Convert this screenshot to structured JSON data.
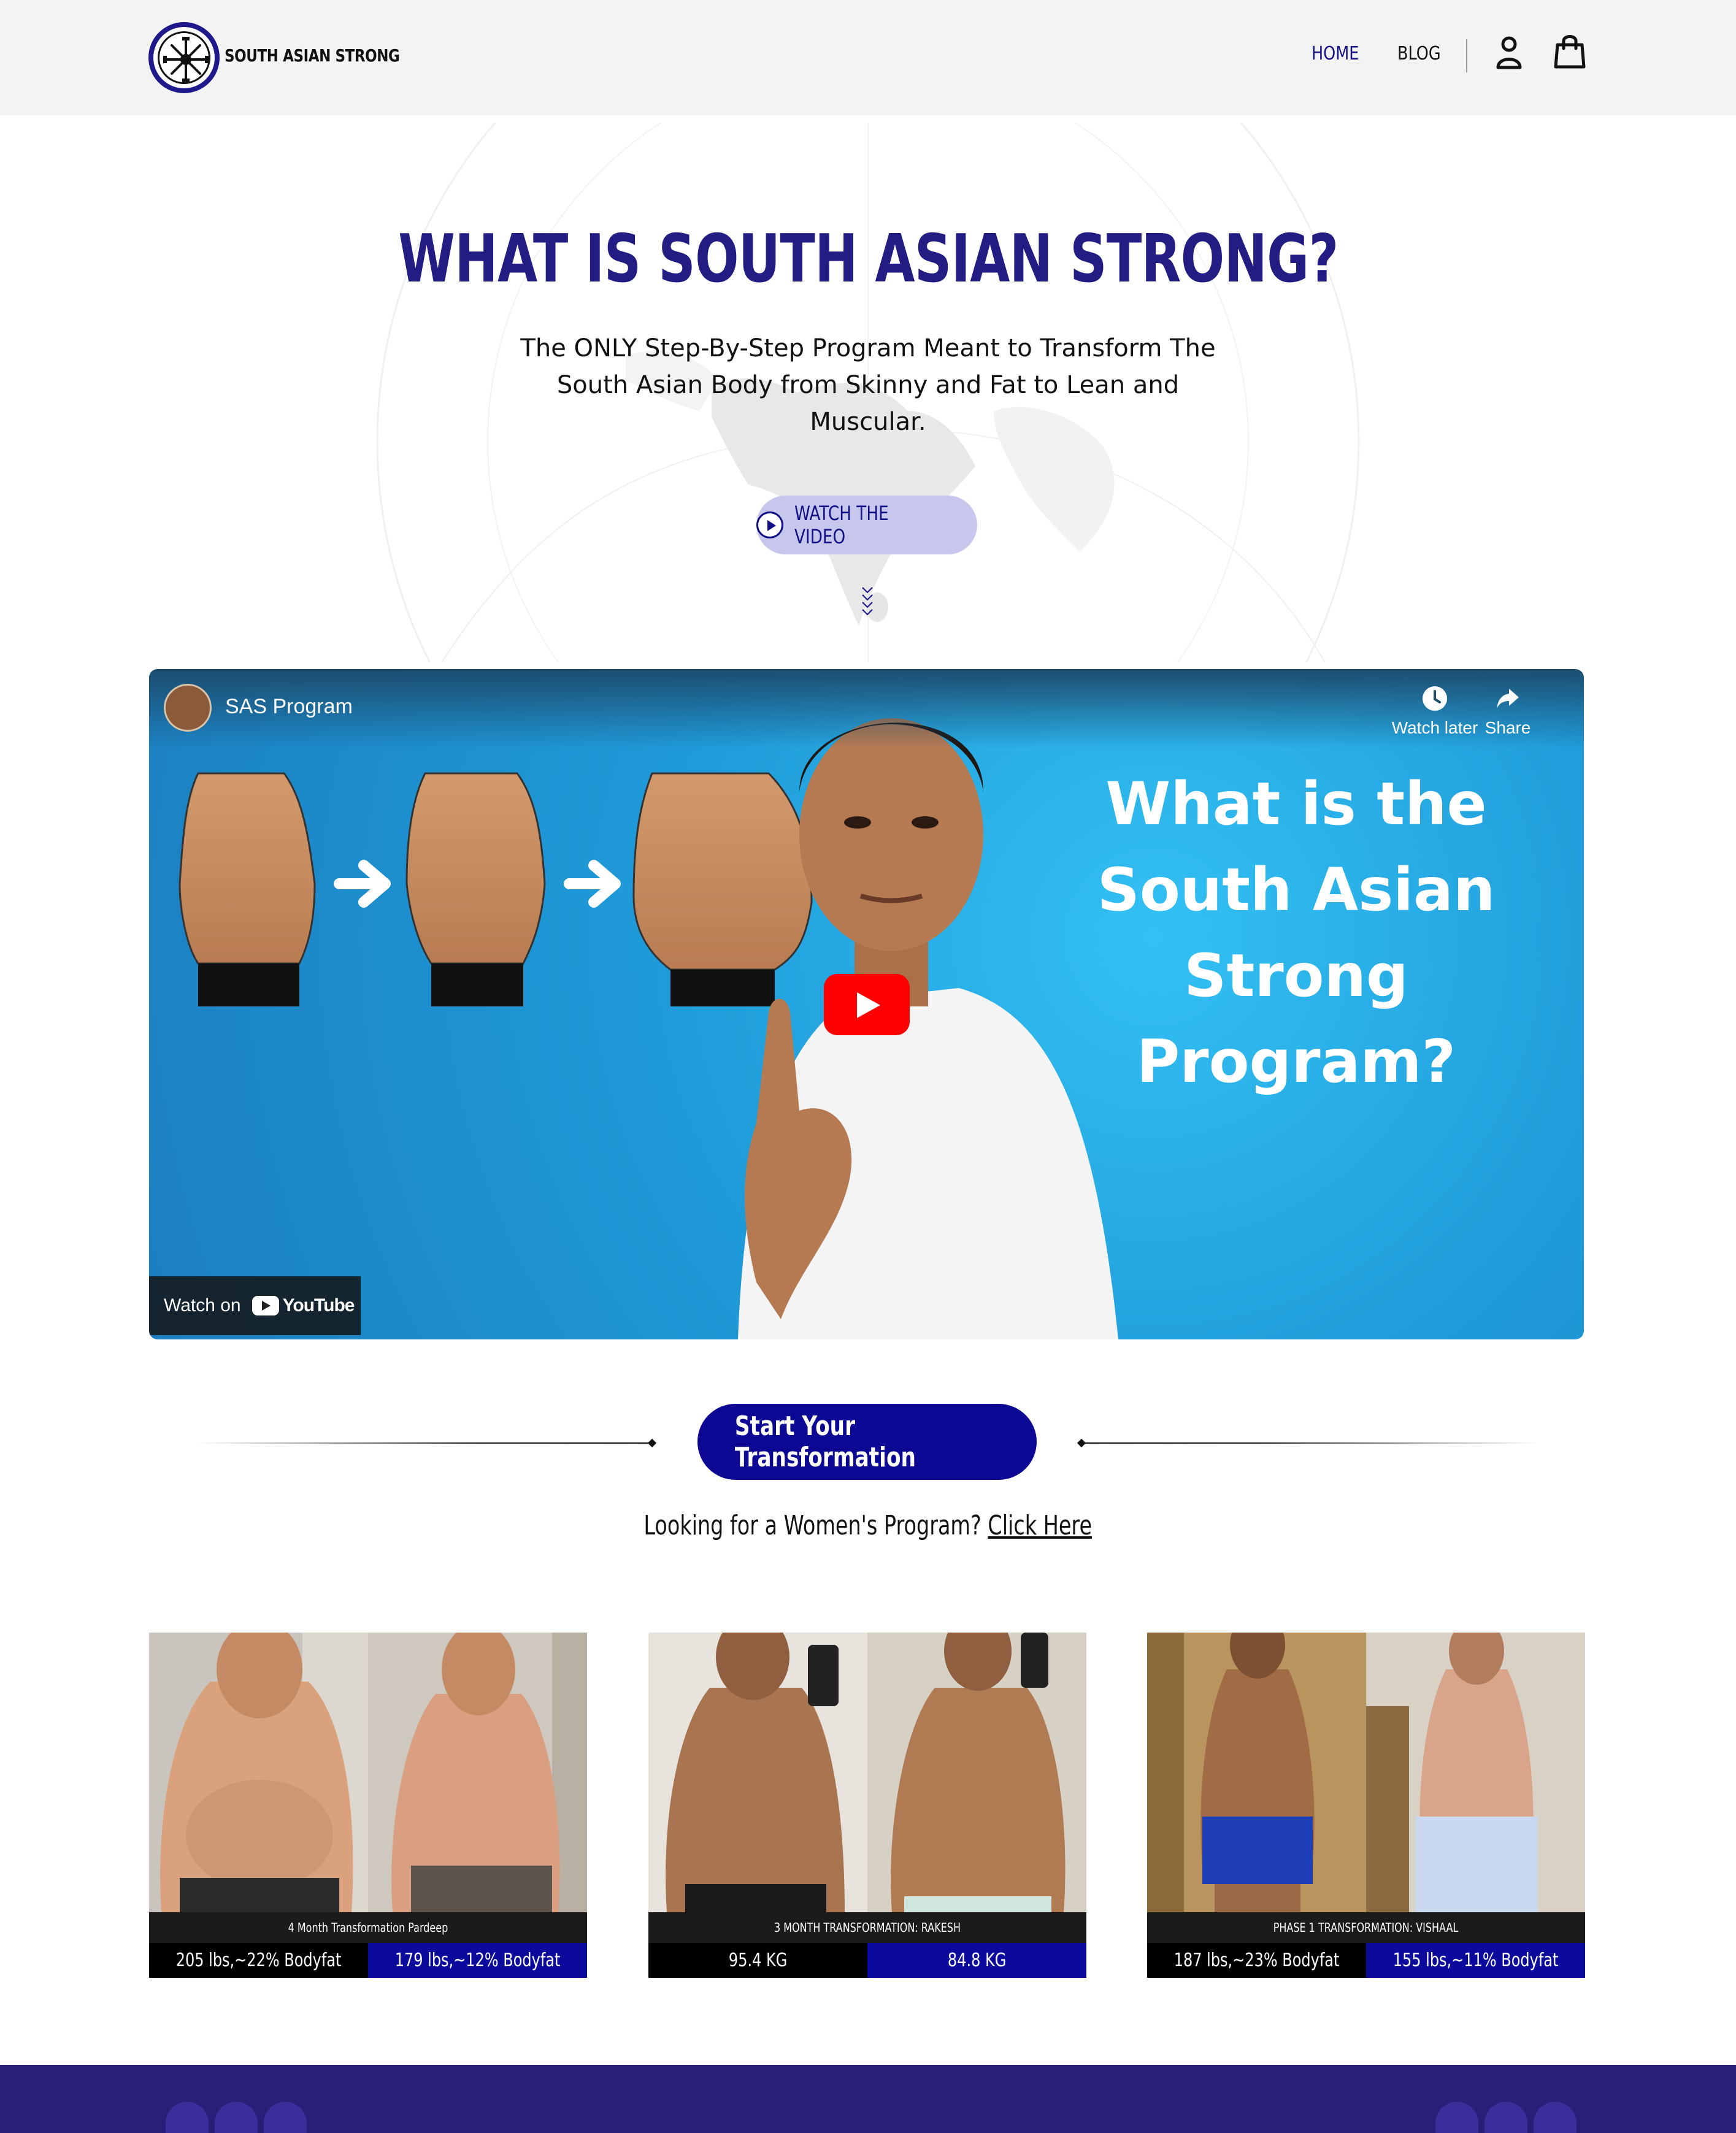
{
  "header": {
    "brand": "SOUTH ASIAN STRONG",
    "nav": {
      "home": "HOME",
      "blog": "BLOG"
    },
    "icons": {
      "logo": "dumbbell-wheel-logo",
      "account": "user-icon",
      "cart": "shopping-bag-icon"
    },
    "colors": {
      "active_nav": "#130f86"
    }
  },
  "hero": {
    "title": "WHAT IS SOUTH ASIAN STRONG?",
    "subtitle": "The ONLY Step-By-Step Program Meant to Transform The South Asian Body from Skinny and Fat to Lean and Muscular.",
    "watch_button": "WATCH THE VIDEO",
    "colors": {
      "title": "#231c83",
      "button_bg": "#c7c7ee"
    }
  },
  "video": {
    "channel": "SAS Program",
    "watch_later": "Watch later",
    "share": "Share",
    "overlay_text": "What is the South Asian Strong Program?",
    "watch_on": "Watch on",
    "youtube": "YouTube"
  },
  "cta": {
    "button": "Start Your Transformation",
    "women_prompt": "Looking for a Women's Program?",
    "women_link": "Click Here",
    "colors": {
      "button_bg": "#0c0893"
    }
  },
  "transformations": [
    {
      "caption": "4 Month Transformation Pardeep",
      "before": "205 lbs,~22% Bodyfat",
      "after": "179 lbs,~12% Bodyfat"
    },
    {
      "caption": "3 MONTH TRANSFORMATION: RAKESH",
      "before": "95.4 KG",
      "after": "84.8 KG"
    },
    {
      "caption": "PHASE 1 TRANSFORMATION: VISHAAL",
      "before": "187 lbs,~23% Bodyfat",
      "after": "155 lbs,~11% Bodyfat"
    }
  ]
}
